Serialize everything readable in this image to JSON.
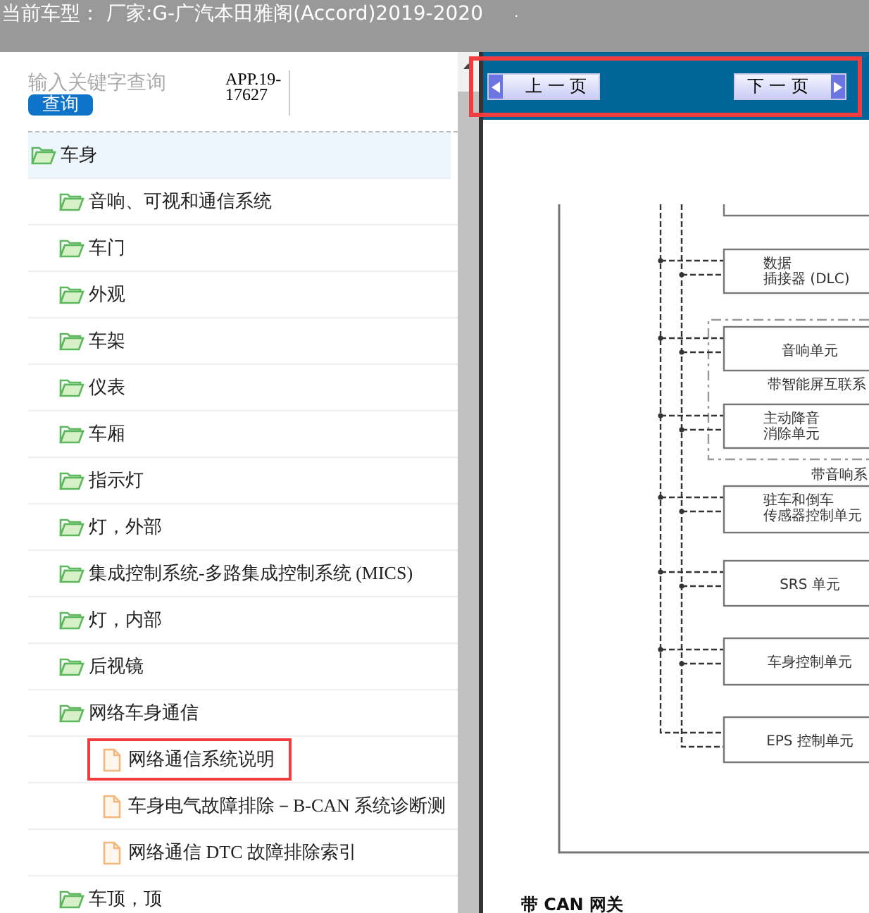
{
  "top_bar": {
    "title": "当前车型： 厂家:G-广汽本田雅阁(Accord)2019-2020",
    "mark": "."
  },
  "search": {
    "placeholder": "输入关键字查询",
    "button": "查询",
    "version": "APP.19-17627"
  },
  "tree": [
    {
      "label": "车身",
      "kind": "folder",
      "selected": true,
      "highlighted": false,
      "children": [
        {
          "label": "音响、可视和通信系统",
          "kind": "folder",
          "selected": false,
          "highlighted": false
        },
        {
          "label": "车门",
          "kind": "folder",
          "selected": false,
          "highlighted": false
        },
        {
          "label": "外观",
          "kind": "folder",
          "selected": false,
          "highlighted": false
        },
        {
          "label": "车架",
          "kind": "folder",
          "selected": false,
          "highlighted": false
        },
        {
          "label": "仪表",
          "kind": "folder",
          "selected": false,
          "highlighted": false
        },
        {
          "label": "车厢",
          "kind": "folder",
          "selected": false,
          "highlighted": false
        },
        {
          "label": "指示灯",
          "kind": "folder",
          "selected": false,
          "highlighted": false
        },
        {
          "label": "灯，外部",
          "kind": "folder",
          "selected": false,
          "highlighted": false
        },
        {
          "label": "集成控制系统-多路集成控制系统 (MICS)",
          "kind": "folder",
          "selected": false,
          "highlighted": false
        },
        {
          "label": "灯，内部",
          "kind": "folder",
          "selected": false,
          "highlighted": false
        },
        {
          "label": "后视镜",
          "kind": "folder",
          "selected": false,
          "highlighted": false
        },
        {
          "label": "网络车身通信",
          "kind": "folder",
          "selected": false,
          "highlighted": false,
          "children": [
            {
              "label": "网络通信系统说明",
              "kind": "document",
              "selected": false,
              "highlighted": true
            },
            {
              "label": "车身电气故障排除－B-CAN 系统诊断测",
              "kind": "document",
              "selected": false,
              "highlighted": false
            },
            {
              "label": "网络通信 DTC 故障排除索引",
              "kind": "document",
              "selected": false,
              "highlighted": false
            }
          ]
        },
        {
          "label": "车顶，顶",
          "kind": "folder",
          "selected": false,
          "highlighted": false
        }
      ]
    }
  ],
  "nav": {
    "highlighted": true,
    "prev": "上 一 页",
    "next": "下 一 页"
  },
  "diagram": {
    "modules": [
      {
        "lines": [
          "数据",
          "插接器 (DLC)"
        ]
      },
      {
        "lines": [
          "音响单元"
        ]
      },
      {
        "lines": [
          "主动降音",
          "消除单元"
        ]
      },
      {
        "lines": [
          "驻车和倒车",
          "传感器控制单元"
        ]
      },
      {
        "lines": [
          "SRS 单元"
        ]
      },
      {
        "lines": [
          "车身控制单元"
        ]
      },
      {
        "lines": [
          "EPS 控制单元"
        ]
      }
    ],
    "group_labels": [
      "带智能屏互联系",
      "带音响系"
    ],
    "caption": "带 CAN 网关"
  }
}
